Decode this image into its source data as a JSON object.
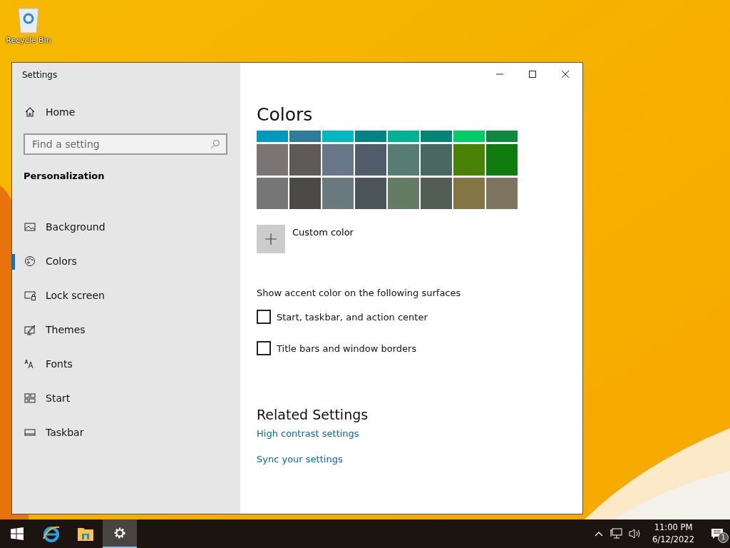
{
  "desktop": {
    "icons": [
      {
        "label": "Recycle Bin"
      }
    ]
  },
  "window": {
    "title": "Settings"
  },
  "sidebar": {
    "home": "Home",
    "search": {
      "placeholder": "Find a setting"
    },
    "section": "Personalization",
    "items": [
      {
        "label": "Background",
        "kind": "background",
        "selected": false
      },
      {
        "label": "Colors",
        "kind": "colors",
        "selected": true
      },
      {
        "label": "Lock screen",
        "kind": "lock",
        "selected": false
      },
      {
        "label": "Themes",
        "kind": "themes",
        "selected": false
      },
      {
        "label": "Fonts",
        "kind": "fonts",
        "selected": false
      },
      {
        "label": "Start",
        "kind": "start",
        "selected": false
      },
      {
        "label": "Taskbar",
        "kind": "taskbar",
        "selected": false
      }
    ]
  },
  "content": {
    "title": "Colors",
    "swatch_rows": [
      [
        {
          "color": "#0099bc"
        },
        {
          "color": "#2d7d9a"
        },
        {
          "color": "#00b7c3"
        },
        {
          "color": "#038387"
        },
        {
          "color": "#00b294"
        },
        {
          "color": "#018574"
        },
        {
          "color": "#00cc6a"
        },
        {
          "color": "#10893e"
        }
      ],
      [
        {
          "color": "#7a7574"
        },
        {
          "color": "#5d5a58"
        },
        {
          "color": "#68768a"
        },
        {
          "color": "#515c6b"
        },
        {
          "color": "#567c73"
        },
        {
          "color": "#486860"
        },
        {
          "color": "#498205"
        },
        {
          "color": "#107c10"
        }
      ],
      [
        {
          "color": "#767676"
        },
        {
          "color": "#4c4a48"
        },
        {
          "color": "#69797e"
        },
        {
          "color": "#4a5459"
        },
        {
          "color": "#647c64"
        },
        {
          "color": "#525e54"
        },
        {
          "color": "#847545"
        },
        {
          "color": "#7e735f"
        }
      ]
    ],
    "custom_color": "Custom color",
    "surfaces_heading": "Show accent color on the following surfaces",
    "surfaces": [
      {
        "label": "Start, taskbar, and action center",
        "checked": false
      },
      {
        "label": "Title bars and window borders",
        "checked": false
      }
    ],
    "related_heading": "Related Settings",
    "links": [
      "High contrast settings",
      "Sync your settings"
    ]
  },
  "taskbar": {
    "apps": [
      {
        "kind": "browser",
        "selected": false
      },
      {
        "kind": "folder",
        "selected": false
      },
      {
        "kind": "settings",
        "selected": true
      }
    ],
    "time": "11:00 PM",
    "date": "6/12/2022",
    "notifications": "1"
  }
}
